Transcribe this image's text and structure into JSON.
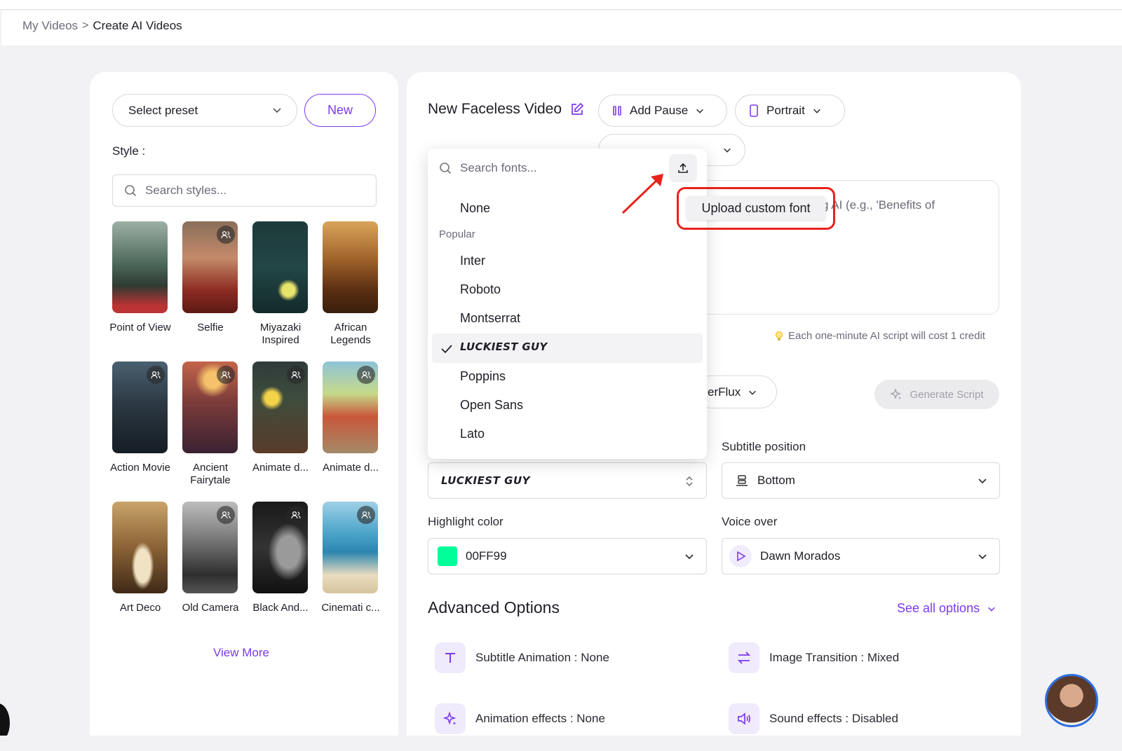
{
  "breadcrumb": {
    "parent": "My Videos",
    "separator": ">",
    "current": "Create AI Videos"
  },
  "left_panel": {
    "preset_placeholder": "Select preset",
    "new_label": "New",
    "style_label": "Style :",
    "search_placeholder": "Search styles...",
    "styles": [
      {
        "name": "Point of View"
      },
      {
        "name": "Selfie"
      },
      {
        "name": "Miyazaki Inspired"
      },
      {
        "name": "African Legends"
      },
      {
        "name": "Action Movie"
      },
      {
        "name": "Ancient Fairytale"
      },
      {
        "name": "Animate d..."
      },
      {
        "name": "Animate d..."
      },
      {
        "name": "Art Deco"
      },
      {
        "name": "Old Camera"
      },
      {
        "name": "Black And..."
      },
      {
        "name": "Cinemati c..."
      }
    ],
    "view_more": "View More"
  },
  "main": {
    "title": "New Faceless Video",
    "add_pause": "Add Pause",
    "orientation": "Portrait",
    "textarea_hint_partial": "g AI (e.g., 'Benefits of",
    "credit_note": "Each one-minute AI script will cost 1 credit",
    "model_partial": "erFlux",
    "generate_script": "Generate Script",
    "subtitle_position_label": "Subtitle position",
    "subtitle_position_value": "Bottom",
    "font_value": "LUCKIEST GUY",
    "highlight_color_label": "Highlight color",
    "highlight_color_value": "00FF99",
    "highlight_color_hex": "#00FF99",
    "voice_over_label": "Voice over",
    "voice_over_value": "Dawn Morados",
    "advanced_title": "Advanced Options",
    "see_all": "See all options",
    "options": {
      "subtitle_animation": "Subtitle Animation : None",
      "image_transition": "Image Transition : Mixed",
      "animation_effects": "Animation effects : None",
      "sound_effects": "Sound effects : Disabled"
    }
  },
  "font_dropdown": {
    "search_placeholder": "Search fonts...",
    "none": "None",
    "group_popular": "Popular",
    "fonts": [
      "Inter",
      "Roboto",
      "Montserrat",
      "LUCKIEST GUY",
      "Poppins",
      "Open Sans",
      "Lato"
    ],
    "selected": "LUCKIEST GUY"
  },
  "tooltip": {
    "text": "Upload custom font"
  },
  "colors": {
    "accent": "#7c3aed",
    "annotation_red": "#e8221b"
  }
}
